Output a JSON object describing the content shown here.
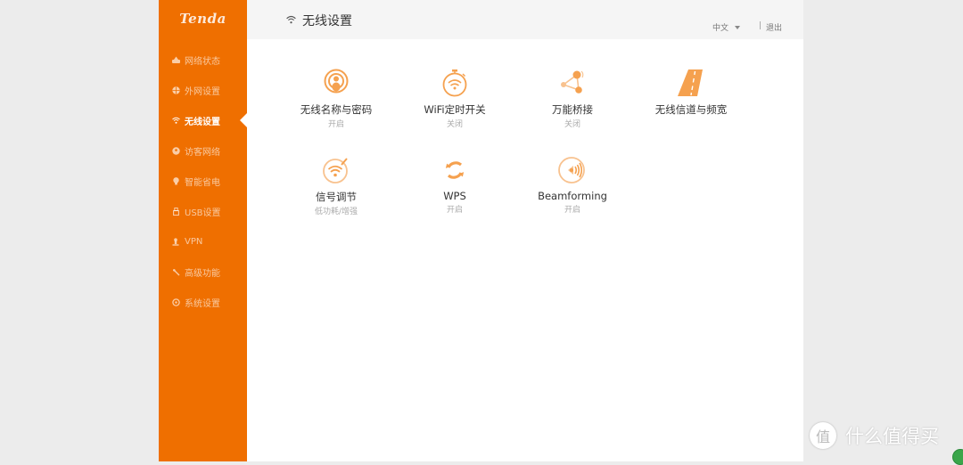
{
  "brand": {
    "logo": "Tenda",
    "accent_color": "#ef6f00",
    "icon_color": "#f5a14f"
  },
  "sidebar": {
    "items": [
      {
        "label": "网络状态",
        "icon": "router-icon",
        "active": false
      },
      {
        "label": "外网设置",
        "icon": "globe-icon",
        "active": false
      },
      {
        "label": "无线设置",
        "icon": "wifi-icon",
        "active": true
      },
      {
        "label": "访客网络",
        "icon": "guest-icon",
        "active": false
      },
      {
        "label": "智能省电",
        "icon": "bulb-icon",
        "active": false
      },
      {
        "label": "USB设置",
        "icon": "usb-icon",
        "active": false
      },
      {
        "label": "VPN",
        "icon": "vpn-icon",
        "active": false
      },
      {
        "label": "高级功能",
        "icon": "wrench-icon",
        "active": false
      },
      {
        "label": "系统设置",
        "icon": "gear-icon",
        "active": false
      }
    ]
  },
  "header": {
    "title": "无线设置",
    "language": "中文",
    "separator": "|",
    "logout": "退出"
  },
  "tiles": [
    {
      "name": "无线名称与密码",
      "status": "开启",
      "icon": "wifi-pin-icon"
    },
    {
      "name": "WiFi定时开关",
      "status": "关闭",
      "icon": "wifi-timer-icon"
    },
    {
      "name": "万能桥接",
      "status": "关闭",
      "icon": "bridge-icon"
    },
    {
      "name": "无线信道与频宽",
      "status": "",
      "icon": "road-icon"
    },
    {
      "name": "信号调节",
      "status": "低功耗/增强",
      "icon": "signal-adjust-icon"
    },
    {
      "name": "WPS",
      "status": "开启",
      "icon": "wps-sync-icon"
    },
    {
      "name": "Beamforming",
      "status": "开启",
      "icon": "beamforming-icon"
    }
  ],
  "watermark": {
    "badge": "值",
    "text": "什么值得买"
  }
}
